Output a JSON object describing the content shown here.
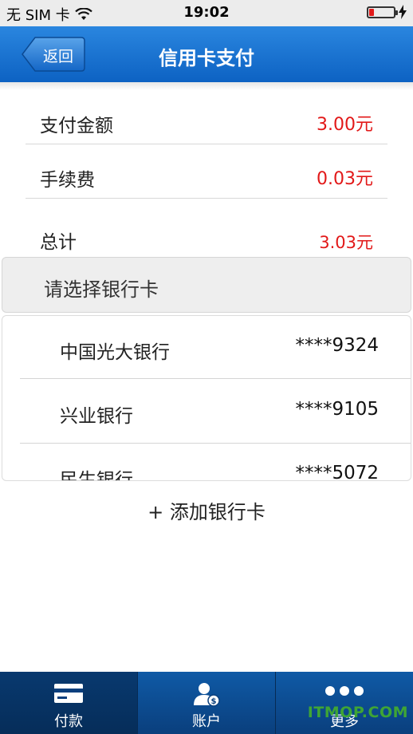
{
  "status_bar": {
    "carrier": "无 SIM 卡",
    "time": "19:02"
  },
  "nav": {
    "back_label": "返回",
    "title": "信用卡支付"
  },
  "summary": {
    "amount_label": "支付金额",
    "amount_value": "3.00元",
    "fee_label": "手续费",
    "fee_value": "0.03元",
    "total_label": "总计",
    "total_value": "3.03元"
  },
  "bank_section": {
    "header": "请选择银行卡",
    "cards": [
      {
        "name": "中国光大银行",
        "number": "****9324"
      },
      {
        "name": "兴业银行",
        "number": "****9105"
      },
      {
        "name": "民生银行",
        "number": "****5072"
      }
    ],
    "add_label": "+ 添加银行卡"
  },
  "tabs": [
    {
      "label": "付款",
      "icon": "card-icon",
      "active": true
    },
    {
      "label": "账户",
      "icon": "account-icon",
      "active": false
    },
    {
      "label": "更多",
      "icon": "more-icon",
      "active": false
    }
  ],
  "watermark": "ITMOP.COM",
  "colors": {
    "accent": "#1a73d1",
    "amount_red": "#e21818",
    "tabbar": "#0a3f7d"
  }
}
